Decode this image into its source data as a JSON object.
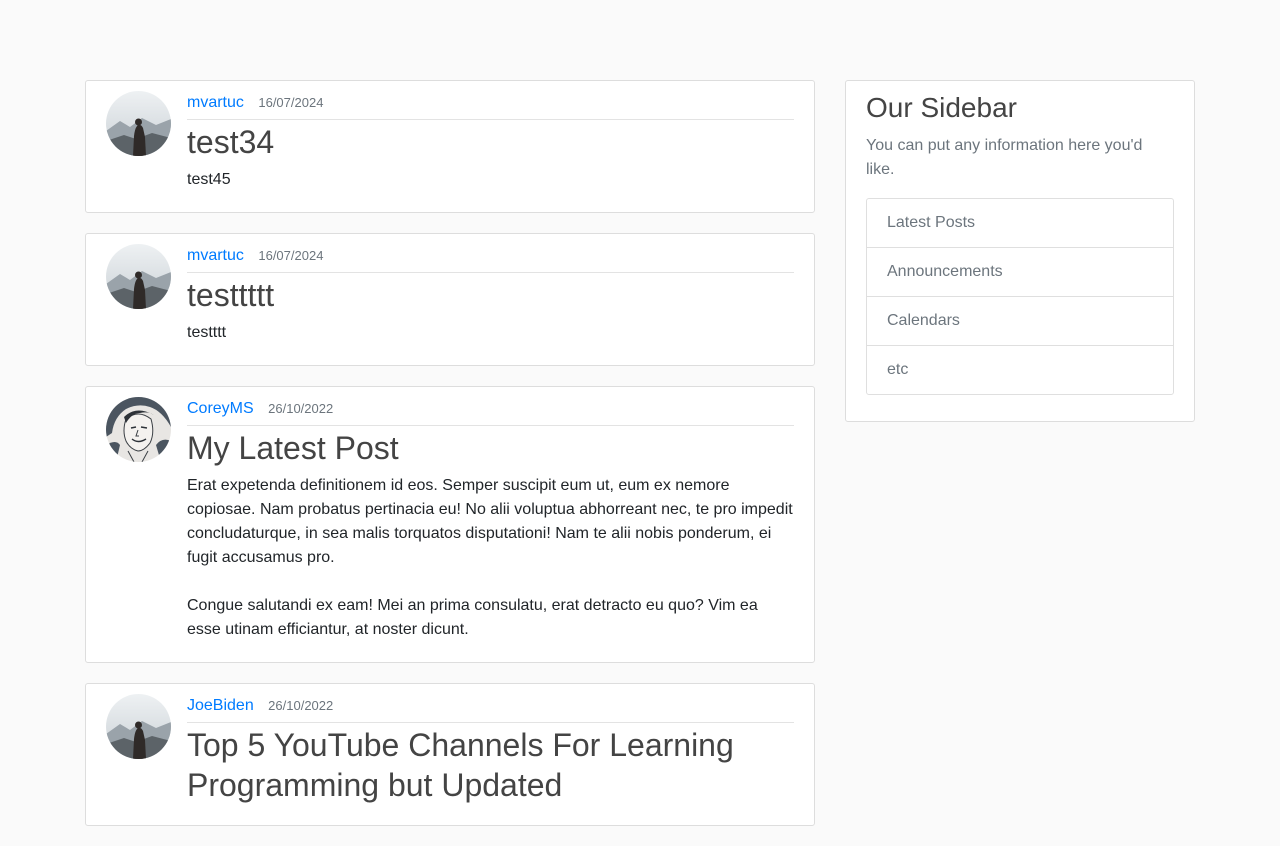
{
  "posts": [
    {
      "author": "mvartuc",
      "date": "16/07/2024",
      "title": "test34",
      "paragraphs": [
        "test45"
      ],
      "avatar_icon": "mountain-silhouette-avatar"
    },
    {
      "author": "mvartuc",
      "date": "16/07/2024",
      "title": "testtttt",
      "paragraphs": [
        "testttt"
      ],
      "avatar_icon": "mountain-silhouette-avatar"
    },
    {
      "author": "CoreyMS",
      "date": "26/10/2022",
      "title": "My Latest Post",
      "paragraphs": [
        "Erat expetenda definitionem id eos. Semper suscipit eum ut, eum ex nemore copiosae. Nam probatus pertinacia eu! No alii voluptua abhorreant nec, te pro impedit concludaturque, in sea malis torquatos disputationi! Nam te alii nobis ponderum, ei fugit accusamus pro.",
        "Congue salutandi ex eam! Mei an prima consulatu, erat detracto eu quo? Vim ea esse utinam efficiantur, at noster dicunt."
      ],
      "avatar_icon": "portrait-sketch-avatar"
    },
    {
      "author": "JoeBiden",
      "date": "26/10/2022",
      "title": "Top 5 YouTube Channels For Learning Programming but Updated",
      "paragraphs": [],
      "avatar_icon": "mountain-silhouette-avatar"
    }
  ],
  "sidebar": {
    "title": "Our Sidebar",
    "text": "You can put any information here you'd like.",
    "items": [
      "Latest Posts",
      "Announcements",
      "Calendars",
      "etc"
    ]
  },
  "colors": {
    "link": "#007bff",
    "muted": "#6c757d",
    "title": "#444444",
    "background": "#fafafa"
  }
}
